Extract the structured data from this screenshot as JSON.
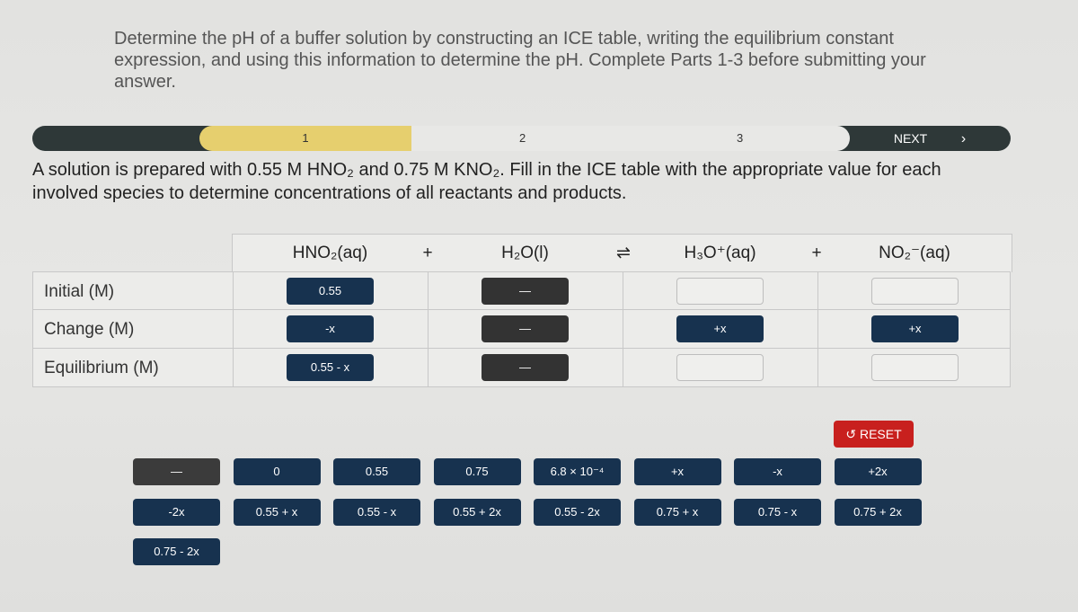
{
  "instructions": "Determine the pH of a buffer solution by constructing an ICE table, writing the equilibrium constant expression, and using this information to determine the pH. Complete Parts 1-3 before submitting your answer.",
  "progress": {
    "steps": [
      "1",
      "2",
      "3"
    ],
    "current_step": 1,
    "next_label": "NEXT",
    "next_icon": "chevron-right-icon"
  },
  "problem": "A solution is prepared with 0.55 M HNO₂ and 0.75 M KNO₂. Fill in the ICE table with the appropriate value for each involved species to determine concentrations of all reactants and products.",
  "table": {
    "species": [
      "HNO₂(aq)",
      "H₂O(l)",
      "H₃O⁺(aq)",
      "NO₂⁻(aq)"
    ],
    "operators": [
      "+",
      "⇌",
      "+"
    ],
    "rows": [
      {
        "label": "Initial (M)",
        "cells": [
          "0.55",
          "—",
          "",
          ""
        ]
      },
      {
        "label": "Change (M)",
        "cells": [
          "-x",
          "—",
          "+x",
          "+x"
        ]
      },
      {
        "label": "Equilibrium (M)",
        "cells": [
          "0.55 - x",
          "—",
          "",
          ""
        ]
      }
    ]
  },
  "reset_label": "RESET",
  "bank": [
    "—",
    "0",
    "0.55",
    "0.75",
    "6.8 × 10⁻⁴",
    "+x",
    "-x",
    "+2x",
    "-2x",
    "0.55 + x",
    "0.55 - x",
    "0.55 + 2x",
    "0.55 - 2x",
    "0.75 + x",
    "0.75 - x",
    "0.75 + 2x",
    "0.75 - 2x"
  ],
  "colors": {
    "button": "#17324f",
    "dash_button": "#333333",
    "reset": "#c8201e",
    "progress_active": "#e6cf6e"
  }
}
